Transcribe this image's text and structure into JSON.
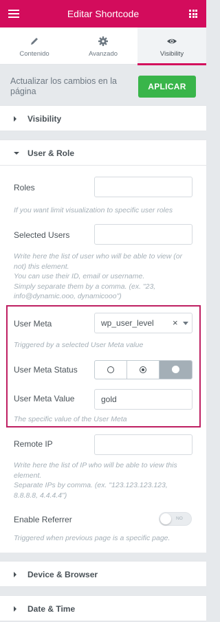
{
  "header": {
    "title": "Editar Shortcode",
    "menu_icon": "hamburger-icon",
    "apps_icon": "grid-icon",
    "color": "#d30c5c"
  },
  "tabs": [
    {
      "label": "Contenido",
      "icon": "pencil-icon"
    },
    {
      "label": "Avanzado",
      "icon": "gear-icon"
    },
    {
      "label": "Visibility",
      "icon": "eye-icon",
      "active": true
    }
  ],
  "update": {
    "text": "Actualizar los cambios en la página",
    "button": "APLICAR"
  },
  "sections": {
    "visibility": "Visibility",
    "user_role": "User & Role",
    "device_browser": "Device & Browser",
    "date_time": "Date & Time"
  },
  "fields": {
    "roles": {
      "label": "Roles",
      "value": "",
      "desc": "If you want limit visualization to specific user roles"
    },
    "selected_users": {
      "label": "Selected Users",
      "value": "",
      "desc": [
        "Write here the list of user who will be able to view (or",
        "not) this element.",
        "You can use their ID, email or username.",
        "Simply separate them by a comma. (ex. \"23,",
        "info@dynamic.ooo, dynamicooo\")"
      ]
    },
    "user_meta": {
      "label": "User Meta",
      "value": "wp_user_level",
      "clear": "×",
      "desc": "Triggered by a selected User Meta value"
    },
    "user_meta_status": {
      "label": "User Meta Status",
      "selected_index": 2
    },
    "user_meta_value": {
      "label": "User Meta Value",
      "value": "gold",
      "desc": "The specific value of the User Meta"
    },
    "remote_ip": {
      "label": "Remote IP",
      "value": "",
      "desc": [
        "Write here the list of IP who will be able to view this",
        "element.",
        "Separate IPs by comma. (ex. \"123.123.123.123,",
        "8.8.8.8, 4.4.4.4\")"
      ]
    },
    "enable_referrer": {
      "label": "Enable Referrer",
      "switch_text": "NO",
      "on": false,
      "desc": "Triggered when previous page is a specific page."
    }
  }
}
